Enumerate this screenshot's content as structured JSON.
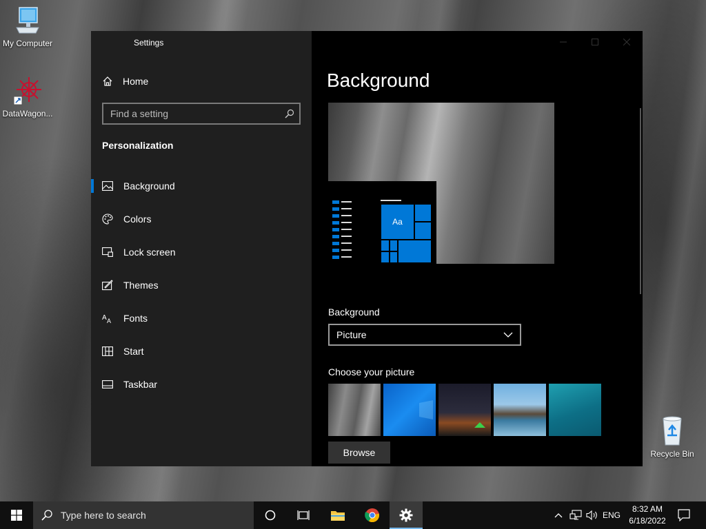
{
  "desktop": {
    "icons": [
      {
        "label": "My Computer",
        "icon": "monitor-icon"
      },
      {
        "label": "DataWagon...",
        "icon": "datawagon-logo-icon"
      },
      {
        "label": "Recycle Bin",
        "icon": "recycle-bin-icon"
      }
    ]
  },
  "window": {
    "title": "Settings",
    "controls": [
      "minimize",
      "maximize",
      "close"
    ]
  },
  "sidebar": {
    "home_label": "Home",
    "search_placeholder": "Find a setting",
    "section_title": "Personalization",
    "items": [
      {
        "label": "Background",
        "icon": "picture-icon",
        "active": true
      },
      {
        "label": "Colors",
        "icon": "palette-icon",
        "active": false
      },
      {
        "label": "Lock screen",
        "icon": "lock-screen-icon",
        "active": false
      },
      {
        "label": "Themes",
        "icon": "themes-icon",
        "active": false
      },
      {
        "label": "Fonts",
        "icon": "fonts-icon",
        "active": false
      },
      {
        "label": "Start",
        "icon": "start-icon",
        "active": false
      },
      {
        "label": "Taskbar",
        "icon": "taskbar-icon",
        "active": false
      }
    ]
  },
  "main": {
    "title": "Background",
    "preview_tile_label": "Aa",
    "background_label": "Background",
    "background_value": "Picture",
    "choose_label": "Choose your picture",
    "browse_label": "Browse",
    "accent_color": "#0078d7"
  },
  "taskbar": {
    "search_placeholder": "Type here to search",
    "language": "ENG",
    "time": "8:32 AM",
    "date": "6/18/2022"
  }
}
